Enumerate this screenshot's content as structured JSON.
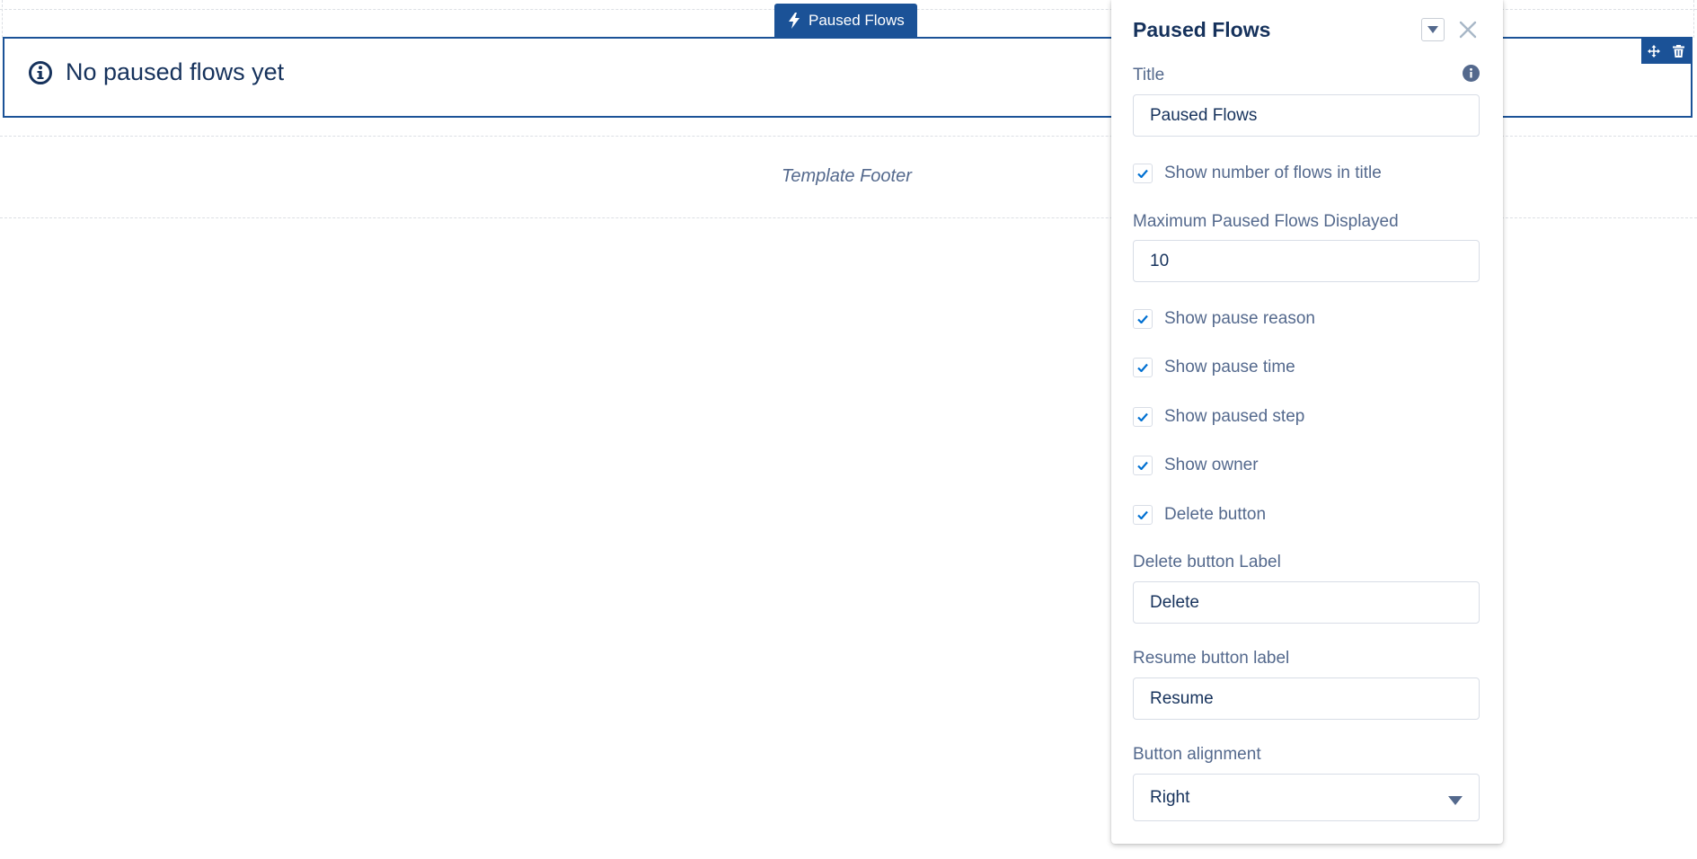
{
  "canvas": {
    "component_tab_label": "Paused Flows",
    "component_message": "No paused flows yet",
    "footer_label": "Template Footer"
  },
  "panel": {
    "title": "Paused Flows",
    "title_field": {
      "label": "Title",
      "value": "Paused Flows"
    },
    "show_count": {
      "label": "Show number of flows in title",
      "checked": true
    },
    "max_displayed": {
      "label": "Maximum Paused Flows Displayed",
      "value": "10"
    },
    "options": [
      {
        "label": "Show pause reason",
        "checked": true
      },
      {
        "label": "Show pause time",
        "checked": true
      },
      {
        "label": "Show paused step",
        "checked": true
      },
      {
        "label": "Show owner",
        "checked": true
      },
      {
        "label": "Delete button",
        "checked": true
      }
    ],
    "delete_label": {
      "label": "Delete button Label",
      "value": "Delete"
    },
    "resume_label": {
      "label": "Resume button label",
      "value": "Resume"
    },
    "alignment": {
      "label": "Button alignment",
      "value": "Right"
    }
  },
  "icons": {
    "tab": "lightning-icon",
    "message": "info-circle-icon",
    "move": "move-icon",
    "delete": "trash-icon",
    "dropdown": "chevron-down-icon",
    "close": "close-icon",
    "info": "info-icon",
    "check": "checkmark-icon",
    "select": "caret-down-icon"
  },
  "colors": {
    "brand": "#1b5297",
    "text_primary": "#16325c",
    "text_secondary": "#54698d",
    "check": "#0070d2"
  }
}
